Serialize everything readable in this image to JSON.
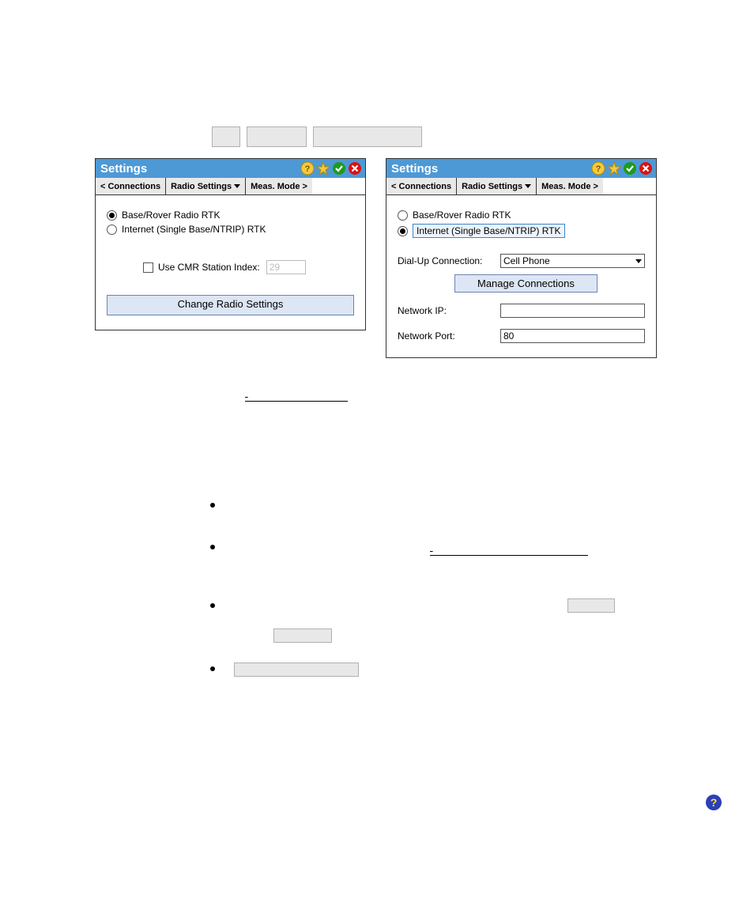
{
  "top_boxes": [
    "",
    "",
    ""
  ],
  "panel_left": {
    "title": "Settings",
    "tabs": {
      "prev": "< Connections",
      "current": "Radio Settings",
      "next": "Meas. Mode >"
    },
    "radio_rtk": "Base/Rover Radio RTK",
    "radio_internet": "Internet (Single Base/NTRIP) RTK",
    "use_cmr_label": "Use CMR Station Index:",
    "use_cmr_value": "29",
    "change_radio_btn": "Change Radio Settings"
  },
  "panel_right": {
    "title": "Settings",
    "tabs": {
      "prev": "< Connections",
      "current": "Radio Settings",
      "next": "Meas. Mode >"
    },
    "radio_rtk": "Base/Rover Radio RTK",
    "radio_internet": "Internet (Single Base/NTRIP) RTK",
    "dial_up_label": "Dial-Up Connection:",
    "dial_up_value": "Cell Phone",
    "manage_conn": "Manage Connections",
    "net_ip_label": "Network IP:",
    "net_ip_value": "",
    "net_port_label": "Network Port:",
    "net_port_value": "80"
  },
  "bullets": {
    "bul1": "",
    "bul2_link": "",
    "bul3_box1": "",
    "bul3_box2": "",
    "bul4_box": ""
  }
}
